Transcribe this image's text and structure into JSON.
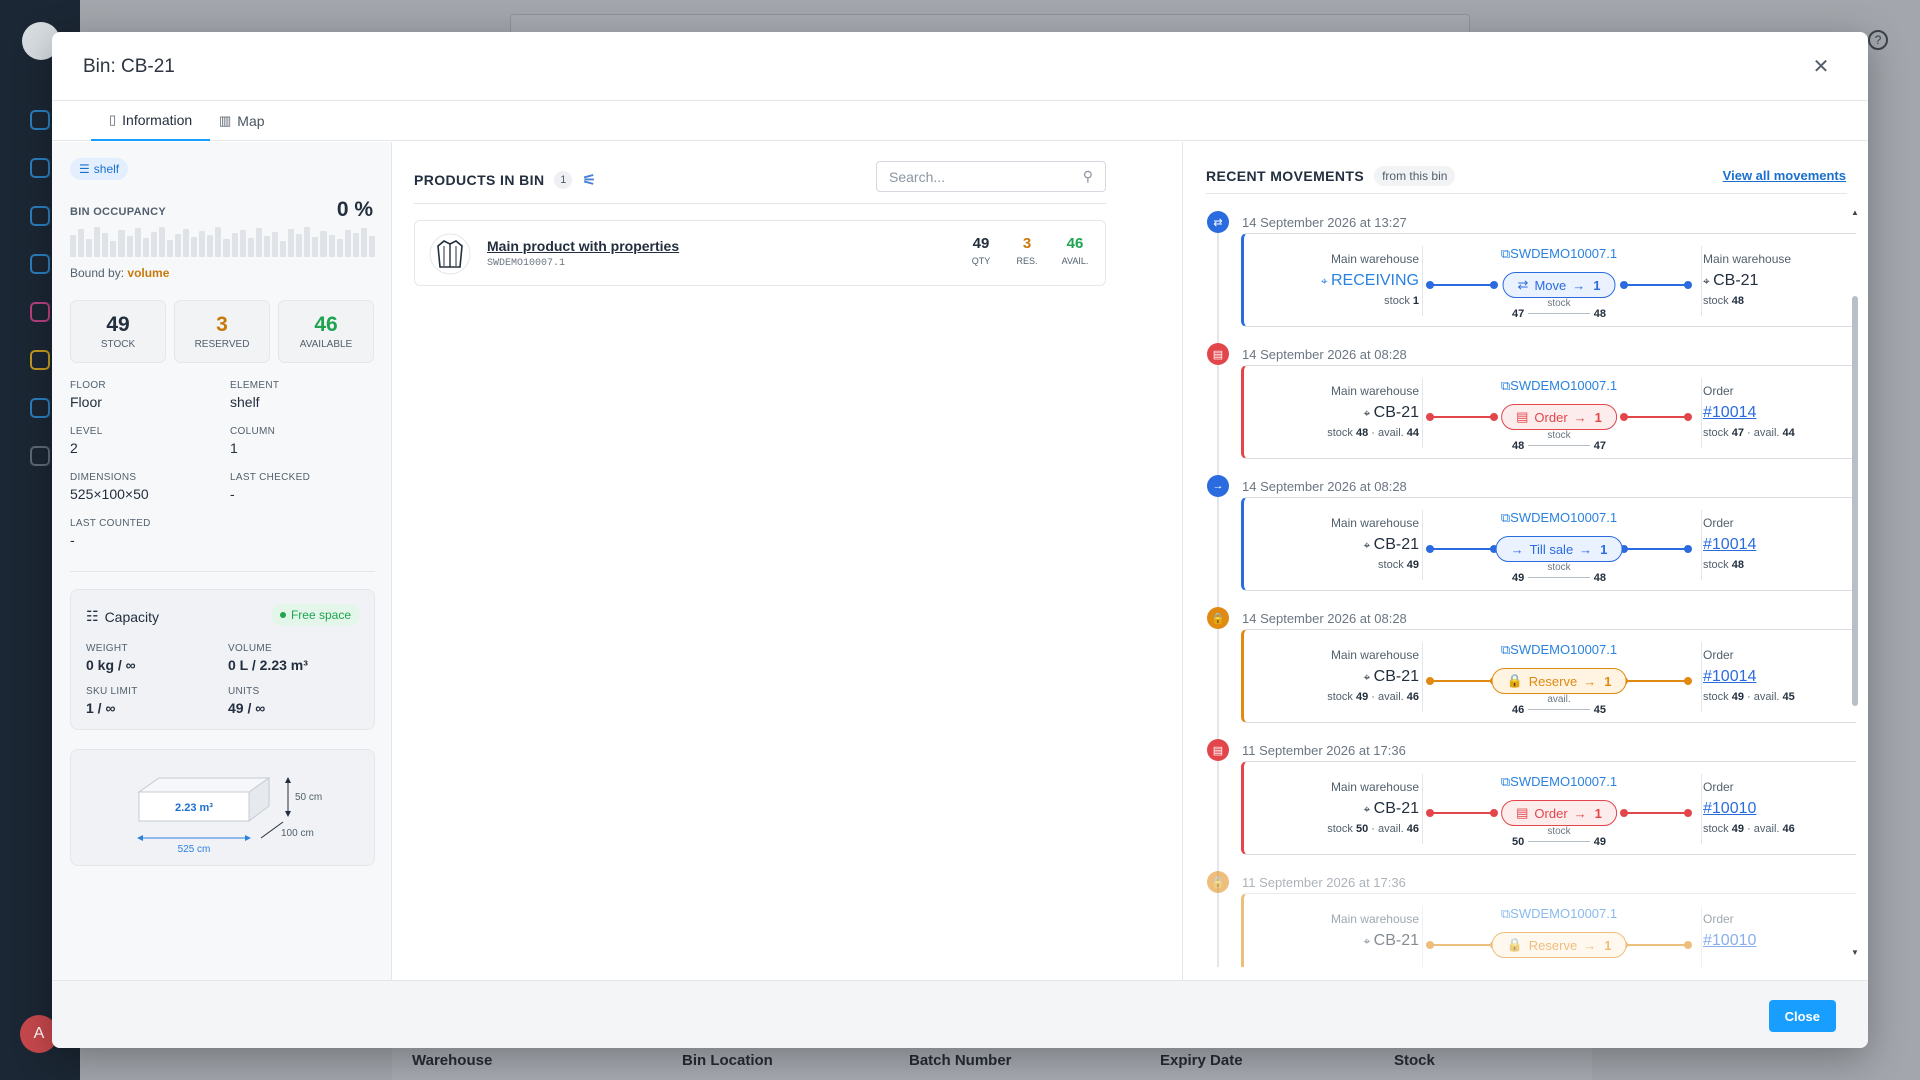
{
  "background": {
    "avatar_initial": "A",
    "help_icon": "?",
    "table_headers": [
      "Warehouse",
      "Bin Location",
      "Batch Number",
      "Expiry Date",
      "Stock"
    ]
  },
  "modal": {
    "title": "Bin: CB-21",
    "tabs": [
      {
        "label": "Information",
        "icon": "document-icon",
        "active": true
      },
      {
        "label": "Map",
        "icon": "map-icon",
        "active": false
      }
    ],
    "close_label": "Close"
  },
  "bin": {
    "element_chip": "shelf",
    "occupancy_label": "BIN OCCUPANCY",
    "occupancy_value": "0 %",
    "bound_by_label": "Bound by:",
    "bound_by_value": "volume",
    "stats": [
      {
        "value": "49",
        "label": "STOCK",
        "color": "#232f3e"
      },
      {
        "value": "3",
        "label": "RESERVED",
        "color": "#c77a0a"
      },
      {
        "value": "46",
        "label": "AVAILABLE",
        "color": "#1ea34f"
      }
    ],
    "info": {
      "floor": {
        "label": "FLOOR",
        "value": "Floor"
      },
      "element": {
        "label": "ELEMENT",
        "value": "shelf"
      },
      "level": {
        "label": "LEVEL",
        "value": "2"
      },
      "column": {
        "label": "COLUMN",
        "value": "1"
      },
      "dimensions": {
        "label": "DIMENSIONS",
        "value": "525×100×50"
      },
      "last_checked": {
        "label": "LAST CHECKED",
        "value": "-"
      },
      "last_counted": {
        "label": "LAST COUNTED",
        "value": "-"
      }
    },
    "capacity": {
      "title": "Capacity",
      "status": "Free space",
      "weight": {
        "label": "WEIGHT",
        "value": "0 kg / ∞"
      },
      "volume": {
        "label": "VOLUME",
        "value": "0 L / 2.23 m³"
      },
      "sku_limit": {
        "label": "SKU LIMIT",
        "value": "1 / ∞"
      },
      "units": {
        "label": "UNITS",
        "value": "49 / ∞"
      }
    },
    "box": {
      "volume": "2.23 m³",
      "height": "50 cm",
      "depth": "100 cm",
      "width": "525 cm"
    }
  },
  "products": {
    "title": "PRODUCTS IN BIN",
    "count": "1",
    "search_placeholder": "Search...",
    "items": [
      {
        "name": "Main product with properties",
        "sku": "SWDEMO10007.1",
        "qty": "49",
        "qty_label": "QTY",
        "res": "3",
        "res_label": "RES.",
        "avail": "46",
        "avail_label": "AVAIL."
      }
    ]
  },
  "movements": {
    "title": "RECENT MOVEMENTS",
    "subtitle": "from this bin",
    "view_all": "View all movements",
    "items": [
      {
        "time": "14 September 2026 at 13:27",
        "kind": "move",
        "color": "#2a6be0",
        "pill_bg": "#eaf2ff",
        "sku": "SWDEMO10007.1",
        "src_wh": "Main warehouse",
        "src_loc": "RECEIVING",
        "src_loc_color": "#2a82e0",
        "src_stock": "1",
        "src_avail": "",
        "action": "Move",
        "qty": "1",
        "delta_label": "stock",
        "delta_from": "47",
        "delta_to": "48",
        "dst_wh": "Main warehouse",
        "dst_loc": "CB-21",
        "dst_is_link": false,
        "dst_stock": "48",
        "dst_avail": ""
      },
      {
        "time": "14 September 2026 at 08:28",
        "kind": "order",
        "color": "#e2464b",
        "pill_bg": "#fdecec",
        "sku": "SWDEMO10007.1",
        "src_wh": "Main warehouse",
        "src_loc": "CB-21",
        "src_loc_color": "#232f3e",
        "src_stock": "48",
        "src_avail": "44",
        "action": "Order",
        "qty": "1",
        "delta_label": "stock",
        "delta_from": "48",
        "delta_to": "47",
        "dst_wh": "Order",
        "dst_loc": "#10014",
        "dst_is_link": true,
        "dst_stock": "47",
        "dst_avail": "44"
      },
      {
        "time": "14 September 2026 at 08:28",
        "kind": "till",
        "color": "#2a6be0",
        "pill_bg": "#eaf2ff",
        "sku": "SWDEMO10007.1",
        "src_wh": "Main warehouse",
        "src_loc": "CB-21",
        "src_loc_color": "#232f3e",
        "src_stock": "49",
        "src_avail": "",
        "action": "Till sale",
        "qty": "1",
        "delta_label": "stock",
        "delta_from": "49",
        "delta_to": "48",
        "dst_wh": "Order",
        "dst_loc": "#10014",
        "dst_is_link": true,
        "dst_stock": "48",
        "dst_avail": ""
      },
      {
        "time": "14 September 2026 at 08:28",
        "kind": "reserve",
        "color": "#e08a12",
        "pill_bg": "#fff4e2",
        "sku": "SWDEMO10007.1",
        "src_wh": "Main warehouse",
        "src_loc": "CB-21",
        "src_loc_color": "#232f3e",
        "src_stock": "49",
        "src_avail": "46",
        "action": "Reserve",
        "qty": "1",
        "delta_label": "avail.",
        "delta_from": "46",
        "delta_to": "45",
        "dst_wh": "Order",
        "dst_loc": "#10014",
        "dst_is_link": true,
        "dst_stock": "49",
        "dst_avail": "45"
      },
      {
        "time": "11 September 2026 at 17:36",
        "kind": "order",
        "color": "#e2464b",
        "pill_bg": "#fdecec",
        "sku": "SWDEMO10007.1",
        "src_wh": "Main warehouse",
        "src_loc": "CB-21",
        "src_loc_color": "#232f3e",
        "src_stock": "50",
        "src_avail": "46",
        "action": "Order",
        "qty": "1",
        "delta_label": "stock",
        "delta_from": "50",
        "delta_to": "49",
        "dst_wh": "Order",
        "dst_loc": "#10010",
        "dst_is_link": true,
        "dst_stock": "49",
        "dst_avail": "46"
      },
      {
        "time": "11 September 2026 at 17:36",
        "kind": "reserve",
        "color": "#e08a12",
        "pill_bg": "#fff4e2",
        "sku": "SWDEMO10007.1",
        "src_wh": "Main warehouse",
        "src_loc": "CB-21",
        "src_loc_color": "#232f3e",
        "src_stock": "",
        "src_avail": "",
        "action": "Reserve",
        "qty": "1",
        "delta_label": "",
        "delta_from": "",
        "delta_to": "",
        "dst_wh": "Order",
        "dst_loc": "#10010",
        "dst_is_link": true,
        "dst_stock": "",
        "dst_avail": ""
      }
    ]
  }
}
